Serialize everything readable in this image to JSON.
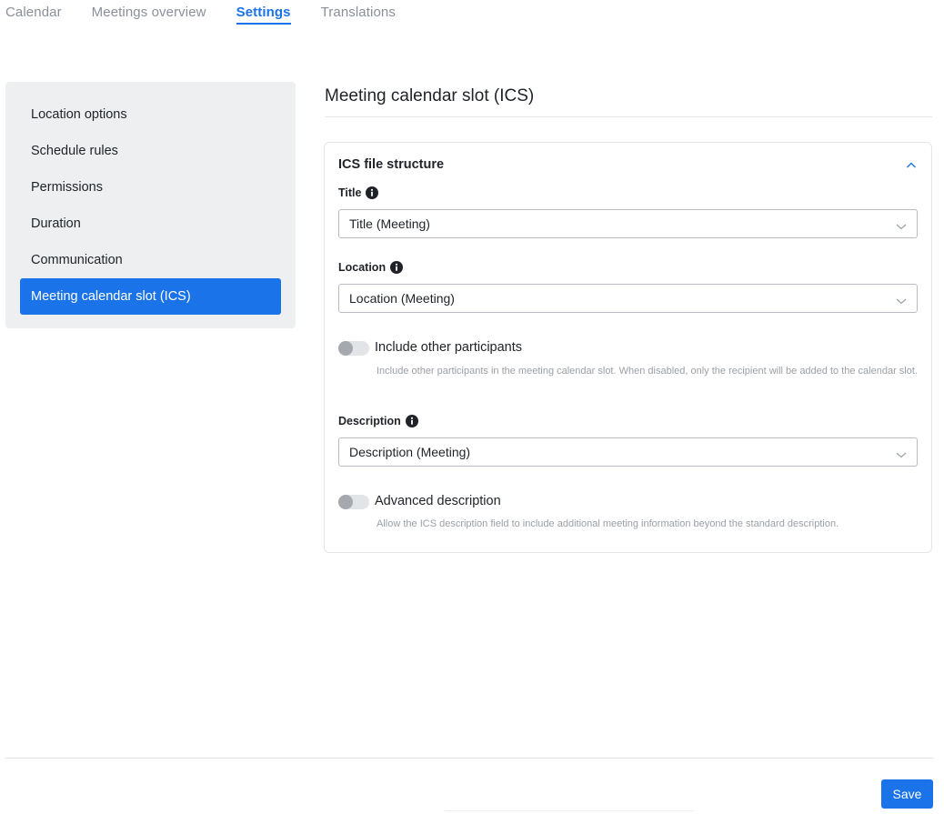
{
  "nav": {
    "tabs": [
      {
        "label": "Calendar",
        "active": false
      },
      {
        "label": "Meetings overview",
        "active": false
      },
      {
        "label": "Settings",
        "active": true
      },
      {
        "label": "Translations",
        "active": false
      }
    ]
  },
  "sidebar": {
    "items": [
      {
        "label": "Location options",
        "active": false
      },
      {
        "label": "Schedule rules",
        "active": false
      },
      {
        "label": "Permissions",
        "active": false
      },
      {
        "label": "Duration",
        "active": false
      },
      {
        "label": "Communication",
        "active": false
      },
      {
        "label": "Meeting calendar slot (ICS)",
        "active": true
      }
    ]
  },
  "main": {
    "title": "Meeting calendar slot (ICS)",
    "card": {
      "title": "ICS file structure",
      "collapse_icon": "chevron-up-icon",
      "fields": {
        "title": {
          "label": "Title",
          "icon": "info-icon",
          "value": "Title (Meeting)"
        },
        "location": {
          "label": "Location",
          "icon": "info-icon",
          "value": "Location (Meeting)"
        },
        "include_participants": {
          "label": "Include other participants",
          "enabled": false,
          "help": "Include other participants in the meeting calendar slot. When disabled, only the recipient will be added to the calendar slot."
        },
        "description": {
          "label": "Description",
          "icon": "info-icon",
          "value": "Description (Meeting)"
        },
        "advanced_description": {
          "label": "Advanced description",
          "enabled": false,
          "help": "Allow the ICS description field to include additional meeting information beyond the standard description."
        }
      }
    }
  },
  "footer": {
    "save_label": "Save"
  },
  "colors": {
    "accent": "#1a73e8",
    "sidebar_bg": "#eeeff1",
    "muted_text": "#9aa0a6"
  }
}
